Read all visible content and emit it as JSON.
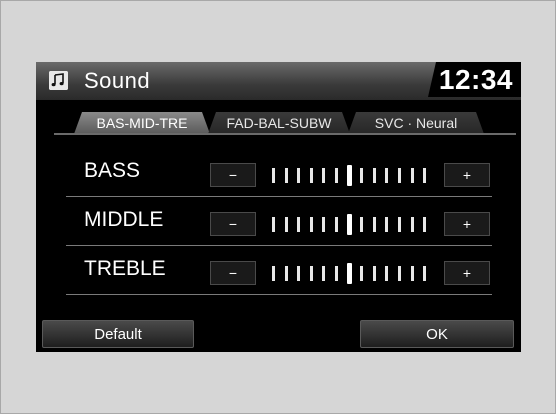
{
  "header": {
    "icon": "music-note-icon",
    "title": "Sound",
    "clock": "12:34"
  },
  "tabs": [
    {
      "label": "BAS-MID-TRE",
      "active": true
    },
    {
      "label": "FAD-BAL-SUBW",
      "active": false
    },
    {
      "label": "SVC · Neural",
      "active": false
    }
  ],
  "rows": [
    {
      "label": "BASS",
      "minus": "−",
      "plus": "+",
      "level": 0
    },
    {
      "label": "MIDDLE",
      "minus": "−",
      "plus": "+",
      "level": 0
    },
    {
      "label": "TREBLE",
      "minus": "−",
      "plus": "+",
      "level": 0
    }
  ],
  "footer": {
    "default_label": "Default",
    "ok_label": "OK"
  }
}
